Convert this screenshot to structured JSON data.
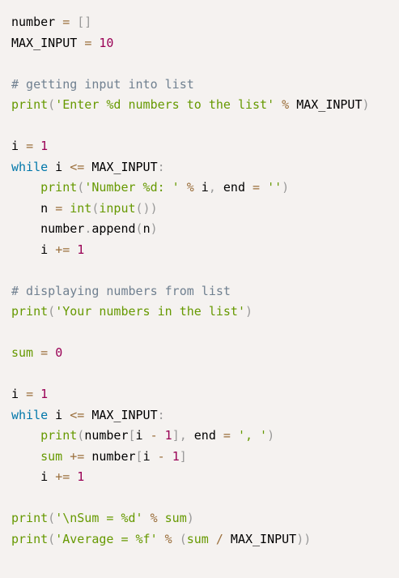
{
  "editor": {
    "background": "#f5f2f0",
    "token_colors": {
      "plain": "#000000",
      "punct": "#999999",
      "op": "#9a6e3a",
      "number": "#990055",
      "string": "#669900",
      "comment": "#708090",
      "keyword": "#0077aa",
      "builtin": "#669900",
      "function": "#dd4a68"
    },
    "lines": [
      [
        [
          "plain",
          "number "
        ],
        [
          "op",
          "="
        ],
        [
          "plain",
          " "
        ],
        [
          "punct",
          "[]"
        ]
      ],
      [
        [
          "plain",
          "MAX_INPUT "
        ],
        [
          "op",
          "="
        ],
        [
          "plain",
          " "
        ],
        [
          "number",
          "10"
        ]
      ],
      [],
      [
        [
          "comment",
          "# getting input into list"
        ]
      ],
      [
        [
          "builtin",
          "print"
        ],
        [
          "punct",
          "("
        ],
        [
          "string",
          "'Enter %d numbers to the list'"
        ],
        [
          "plain",
          " "
        ],
        [
          "op",
          "%"
        ],
        [
          "plain",
          " MAX_INPUT"
        ],
        [
          "punct",
          ")"
        ]
      ],
      [],
      [
        [
          "plain",
          "i "
        ],
        [
          "op",
          "="
        ],
        [
          "plain",
          " "
        ],
        [
          "number",
          "1"
        ]
      ],
      [
        [
          "keyword",
          "while"
        ],
        [
          "plain",
          " i "
        ],
        [
          "op",
          "<="
        ],
        [
          "plain",
          " MAX_INPUT"
        ],
        [
          "punct",
          ":"
        ]
      ],
      [
        [
          "plain",
          "    "
        ],
        [
          "builtin",
          "print"
        ],
        [
          "punct",
          "("
        ],
        [
          "string",
          "'Number %d: '"
        ],
        [
          "plain",
          " "
        ],
        [
          "op",
          "%"
        ],
        [
          "plain",
          " i"
        ],
        [
          "punct",
          ","
        ],
        [
          "plain",
          " end "
        ],
        [
          "op",
          "="
        ],
        [
          "plain",
          " "
        ],
        [
          "string",
          "''"
        ],
        [
          "punct",
          ")"
        ]
      ],
      [
        [
          "plain",
          "    n "
        ],
        [
          "op",
          "="
        ],
        [
          "plain",
          " "
        ],
        [
          "builtin",
          "int"
        ],
        [
          "punct",
          "("
        ],
        [
          "builtin",
          "input"
        ],
        [
          "punct",
          "())"
        ]
      ],
      [
        [
          "plain",
          "    number"
        ],
        [
          "punct",
          "."
        ],
        [
          "plain",
          "append"
        ],
        [
          "punct",
          "("
        ],
        [
          "plain",
          "n"
        ],
        [
          "punct",
          ")"
        ]
      ],
      [
        [
          "plain",
          "    i "
        ],
        [
          "op",
          "+="
        ],
        [
          "plain",
          " "
        ],
        [
          "number",
          "1"
        ]
      ],
      [],
      [
        [
          "comment",
          "# displaying numbers from list"
        ]
      ],
      [
        [
          "builtin",
          "print"
        ],
        [
          "punct",
          "("
        ],
        [
          "string",
          "'Your numbers in the list'"
        ],
        [
          "punct",
          ")"
        ]
      ],
      [],
      [
        [
          "builtin",
          "sum"
        ],
        [
          "plain",
          " "
        ],
        [
          "op",
          "="
        ],
        [
          "plain",
          " "
        ],
        [
          "number",
          "0"
        ]
      ],
      [],
      [
        [
          "plain",
          "i "
        ],
        [
          "op",
          "="
        ],
        [
          "plain",
          " "
        ],
        [
          "number",
          "1"
        ]
      ],
      [
        [
          "keyword",
          "while"
        ],
        [
          "plain",
          " i "
        ],
        [
          "op",
          "<="
        ],
        [
          "plain",
          " MAX_INPUT"
        ],
        [
          "punct",
          ":"
        ]
      ],
      [
        [
          "plain",
          "    "
        ],
        [
          "builtin",
          "print"
        ],
        [
          "punct",
          "("
        ],
        [
          "plain",
          "number"
        ],
        [
          "punct",
          "["
        ],
        [
          "plain",
          "i "
        ],
        [
          "op",
          "-"
        ],
        [
          "plain",
          " "
        ],
        [
          "number",
          "1"
        ],
        [
          "punct",
          "],"
        ],
        [
          "plain",
          " end "
        ],
        [
          "op",
          "="
        ],
        [
          "plain",
          " "
        ],
        [
          "string",
          "', '"
        ],
        [
          "punct",
          ")"
        ]
      ],
      [
        [
          "plain",
          "    "
        ],
        [
          "builtin",
          "sum"
        ],
        [
          "plain",
          " "
        ],
        [
          "op",
          "+="
        ],
        [
          "plain",
          " number"
        ],
        [
          "punct",
          "["
        ],
        [
          "plain",
          "i "
        ],
        [
          "op",
          "-"
        ],
        [
          "plain",
          " "
        ],
        [
          "number",
          "1"
        ],
        [
          "punct",
          "]"
        ]
      ],
      [
        [
          "plain",
          "    i "
        ],
        [
          "op",
          "+="
        ],
        [
          "plain",
          " "
        ],
        [
          "number",
          "1"
        ]
      ],
      [],
      [
        [
          "builtin",
          "print"
        ],
        [
          "punct",
          "("
        ],
        [
          "string",
          "'\\nSum = %d'"
        ],
        [
          "plain",
          " "
        ],
        [
          "op",
          "%"
        ],
        [
          "plain",
          " "
        ],
        [
          "builtin",
          "sum"
        ],
        [
          "punct",
          ")"
        ]
      ],
      [
        [
          "builtin",
          "print"
        ],
        [
          "punct",
          "("
        ],
        [
          "string",
          "'Average = %f'"
        ],
        [
          "plain",
          " "
        ],
        [
          "op",
          "%"
        ],
        [
          "plain",
          " "
        ],
        [
          "punct",
          "("
        ],
        [
          "builtin",
          "sum"
        ],
        [
          "plain",
          " "
        ],
        [
          "op",
          "/"
        ],
        [
          "plain",
          " MAX_INPUT"
        ],
        [
          "punct",
          "))"
        ]
      ]
    ]
  }
}
